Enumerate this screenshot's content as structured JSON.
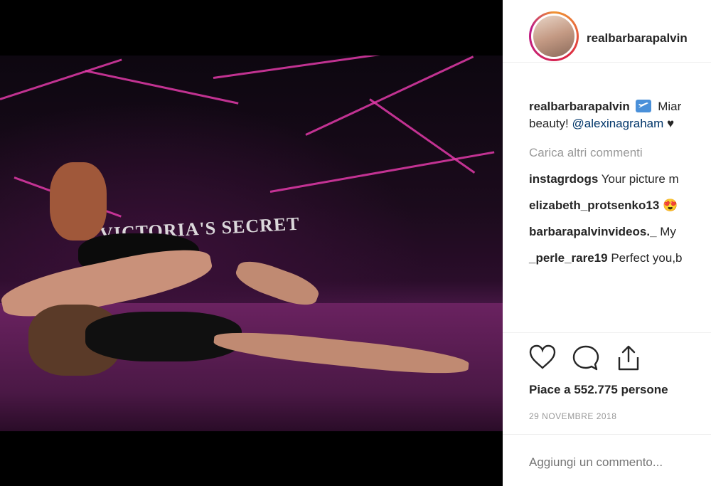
{
  "post": {
    "username": "realbarbarapalvin",
    "sign_text": "VICTORIA'S SECRET",
    "caption_user": "realbarbarapalvin",
    "caption_icon": "airplane-icon",
    "caption_text_1": "Miar",
    "caption_text_2": "beauty!",
    "caption_mention": "@alexinagraham",
    "caption_heart": "♥",
    "load_more": "Carica altri commenti",
    "comments": [
      {
        "user": "instagrdogs",
        "text": "Your picture m"
      },
      {
        "user": "elizabeth_protsenko13",
        "text": "😍"
      },
      {
        "user": "barbarapalvinvideos._",
        "text": "My"
      },
      {
        "user": "_perle_rare19",
        "text": "Perfect you,b"
      }
    ],
    "likes": "Piace a 552.775 persone",
    "date": "29 NOVEMBRE 2018",
    "add_comment_placeholder": "Aggiungi un commento..."
  },
  "colors": {
    "accent": "#262626",
    "mention": "#003569",
    "muted": "#999999",
    "neon": "#e03aa8"
  }
}
